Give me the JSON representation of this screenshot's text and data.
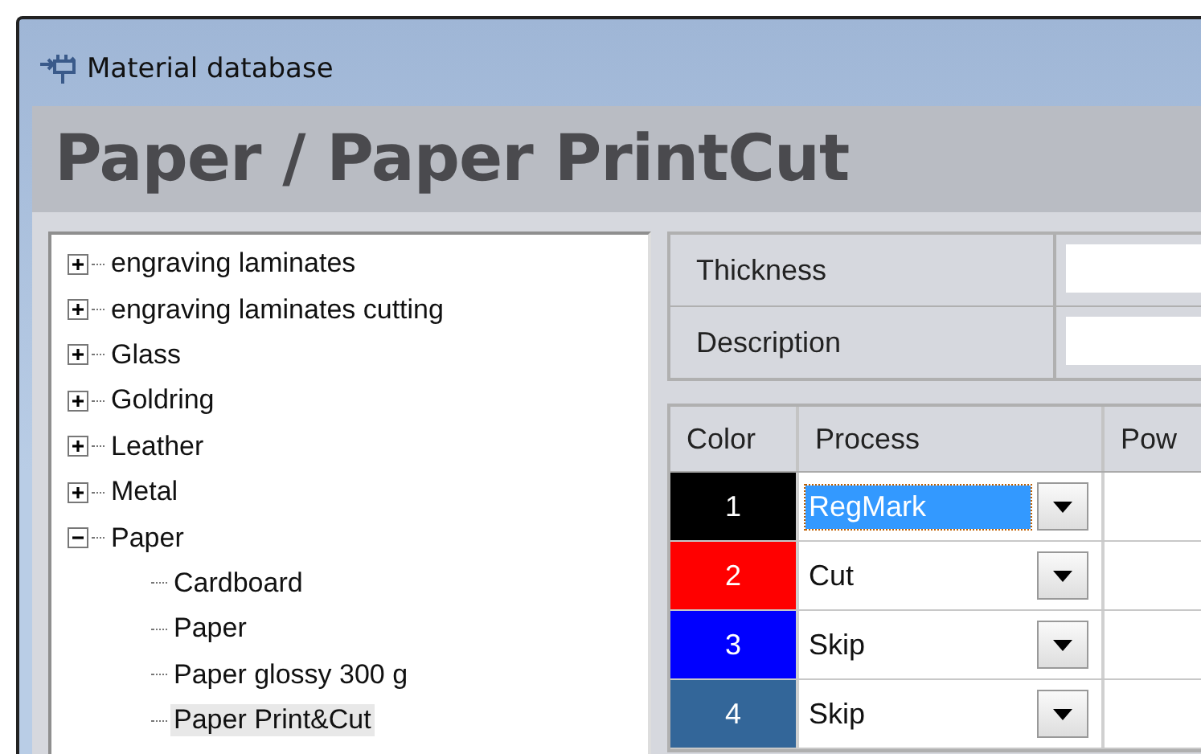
{
  "window": {
    "title": "Material database"
  },
  "header": {
    "title": "Paper / Paper PrintCut"
  },
  "tree": [
    {
      "label": "engraving laminates",
      "expanded": false,
      "selected": false
    },
    {
      "label": "engraving laminates cutting",
      "expanded": false,
      "selected": false
    },
    {
      "label": "Glass",
      "expanded": false,
      "selected": false
    },
    {
      "label": "Goldring",
      "expanded": false,
      "selected": false
    },
    {
      "label": "Leather",
      "expanded": false,
      "selected": false
    },
    {
      "label": "Metal",
      "expanded": false,
      "selected": false
    },
    {
      "label": "Paper",
      "expanded": true,
      "selected": false,
      "children": [
        {
          "label": "Cardboard",
          "selected": false
        },
        {
          "label": "Paper",
          "selected": false
        },
        {
          "label": "Paper glossy 300 g",
          "selected": false
        },
        {
          "label": "Paper Print&Cut",
          "selected": true
        }
      ]
    }
  ],
  "fields": [
    {
      "label": "Thickness"
    },
    {
      "label": "Description"
    }
  ],
  "grid": {
    "columns": [
      "Color",
      "Process",
      "Pow"
    ],
    "rows": [
      {
        "number": "1",
        "color": "#000000",
        "process": "RegMark",
        "selected": true
      },
      {
        "number": "2",
        "color": "#ff0000",
        "process": "Cut",
        "selected": false
      },
      {
        "number": "3",
        "color": "#0000ff",
        "process": "Skip",
        "selected": false
      },
      {
        "number": "4",
        "color": "#336699",
        "process": "Skip",
        "selected": false
      }
    ]
  }
}
